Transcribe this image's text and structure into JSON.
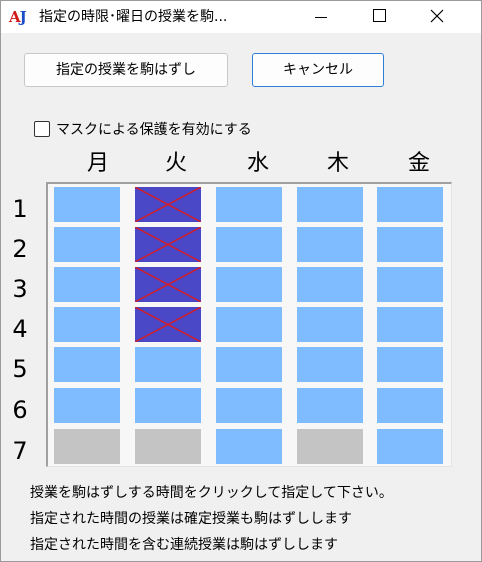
{
  "window": {
    "title": "指定の時限･曜日の授業を駒...",
    "app_icon": "AJ"
  },
  "buttons": {
    "skip_label": "指定の授業を駒はずし",
    "cancel_label": "キャンセル"
  },
  "mask_option": {
    "label": "マスクによる保護を有効にする",
    "checked": false
  },
  "timetable": {
    "days": [
      "月",
      "火",
      "水",
      "木",
      "金"
    ],
    "periods": [
      "1",
      "2",
      "3",
      "4",
      "5",
      "6",
      "7"
    ],
    "cell_states": [
      [
        "available",
        "selected",
        "available",
        "available",
        "available"
      ],
      [
        "available",
        "selected",
        "available",
        "available",
        "available"
      ],
      [
        "available",
        "selected",
        "available",
        "available",
        "available"
      ],
      [
        "available",
        "selected",
        "available",
        "available",
        "available"
      ],
      [
        "available",
        "available",
        "available",
        "available",
        "available"
      ],
      [
        "available",
        "available",
        "available",
        "available",
        "available"
      ],
      [
        "unavailable",
        "unavailable",
        "available",
        "unavailable",
        "available"
      ]
    ],
    "colors": {
      "available": "#7ebbff",
      "unavailable": "#c4c4c4",
      "selected": "#4a48c6",
      "cross": "#e01818"
    }
  },
  "instructions": [
    "授業を駒はずしする時間をクリックして指定して下さい。",
    "指定された時間の授業は確定授業も駒はずしします",
    "指定された時間を含む連続授業は駒はずしします"
  ]
}
